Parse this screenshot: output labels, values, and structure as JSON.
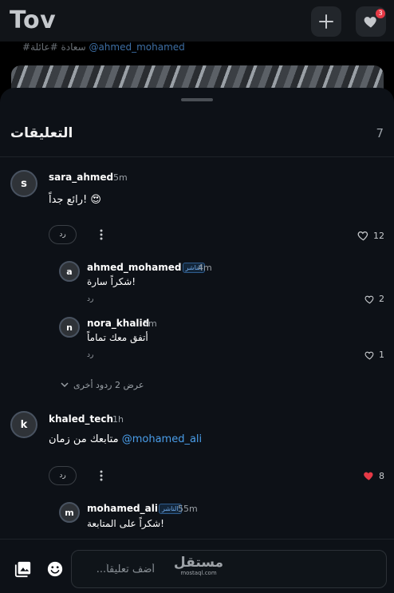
{
  "app": {
    "title": "Tov",
    "notification_count": "3",
    "post_tags": "#سعادة #عائلة",
    "post_mention": "@ahmed_mohamed"
  },
  "sheet": {
    "title": "التعليقات",
    "count": "7",
    "author_badge": "الناشر",
    "reply_label": "رد"
  },
  "comments": [
    {
      "avatar_letter": "s",
      "username": "sara_ahmed",
      "time": "5m",
      "text": "رائع جداً! 😍",
      "likes": "12",
      "liked": false,
      "replies": [
        {
          "avatar_letter": "a",
          "username": "ahmed_mohamed",
          "is_author": true,
          "time": "4m",
          "text": "شكراً سارة!",
          "likes": "2"
        },
        {
          "avatar_letter": "n",
          "username": "nora_khalid",
          "is_author": false,
          "time": "3m",
          "text": "أتفق معك تماماً",
          "likes": "1"
        }
      ],
      "show_more_label": "عرض 2 ردود أخرى"
    },
    {
      "avatar_letter": "k",
      "username": "khaled_tech",
      "time": "1h",
      "text": "متابعك من زمان",
      "mention": "@mohamed_ali",
      "likes": "8",
      "liked": true,
      "replies": [
        {
          "avatar_letter": "m",
          "username": "mohamed_ali",
          "is_author": true,
          "time": "55m",
          "text": "شكراً على المتابعة!"
        }
      ]
    }
  ],
  "composer": {
    "placeholder": "أضف تعليقاً..."
  },
  "watermark": {
    "main": "مستقل",
    "sub": "mostaql.com"
  },
  "colors": {
    "sheet_bg": "#0d1117",
    "mention": "#4a9eea",
    "liked_heart": "#e53946",
    "badge": "#e53946"
  }
}
